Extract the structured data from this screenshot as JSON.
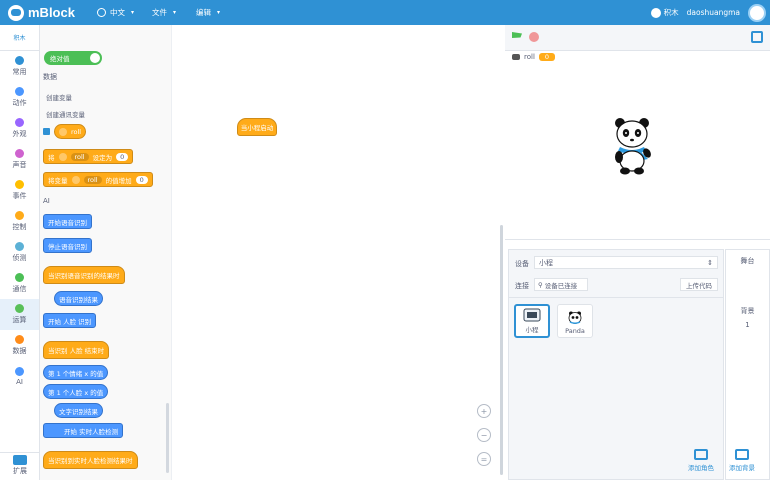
{
  "app": {
    "name": "mBlock"
  },
  "topbar": {
    "language": "中文",
    "file_menu": "文件",
    "edit_menu": "编辑",
    "mode_label": "积木",
    "username": "daoshuangma"
  },
  "categories": {
    "header": "积木",
    "items": [
      {
        "label": "常用",
        "color": "#2f91d4"
      },
      {
        "label": "动作",
        "color": "#4c97ff"
      },
      {
        "label": "外观",
        "color": "#9966ff"
      },
      {
        "label": "声音",
        "color": "#cf63cf"
      },
      {
        "label": "事件",
        "color": "#ffbf00"
      },
      {
        "label": "控制",
        "color": "#ffab19"
      },
      {
        "label": "侦测",
        "color": "#5cb1d6"
      },
      {
        "label": "通信",
        "color": "#4cbf56"
      },
      {
        "label": "运算",
        "color": "#59c059"
      },
      {
        "label": "数据",
        "color": "#ff8c1a"
      },
      {
        "label": "AI",
        "color": "#4c97ff"
      }
    ],
    "extension_label": "扩展"
  },
  "palette": {
    "toggle_label": "绝对值",
    "data_title": "数据",
    "create_variable": "创建变量",
    "create_cloud_variable": "创建通讯变量",
    "variable_name": "roll",
    "set_block": {
      "prefix": "将",
      "var": "roll",
      "mid": "设定为",
      "value": "0"
    },
    "change_block": {
      "prefix": "将变量",
      "var": "roll",
      "mid": "的值增加",
      "value": "0"
    },
    "ai_title": "AI",
    "ai_blocks": [
      "开始语音识别",
      "停止语音识别",
      "当识别语音识别的结果时",
      "语音识别结果",
      "开始 人脸 识别",
      "当识别 人脸 结束时",
      "第 1 个情绪 x 的值",
      "第 1 个人脸 x 的值",
      "文字识别结果",
      "开始 实时人脸检测",
      "当识别到实时人脸检测结果时"
    ]
  },
  "script": {
    "hat_label": "当小程启动"
  },
  "zoom": {
    "in": "+",
    "out": "−",
    "reset": "="
  },
  "stage": {
    "monitor_label": "roll",
    "monitor_value": "0"
  },
  "device": {
    "device_label": "设备",
    "device_value": "小程",
    "connect_label": "连接",
    "connected_status": "设备已连接",
    "upload_label": "上传代码",
    "tiles": [
      {
        "name": "小程"
      },
      {
        "name": "Panda"
      }
    ],
    "add_character": "添加角色"
  },
  "right": {
    "tab": "舞台",
    "bg_label": "背景",
    "bg_count": "1",
    "add_background": "添加背景"
  }
}
